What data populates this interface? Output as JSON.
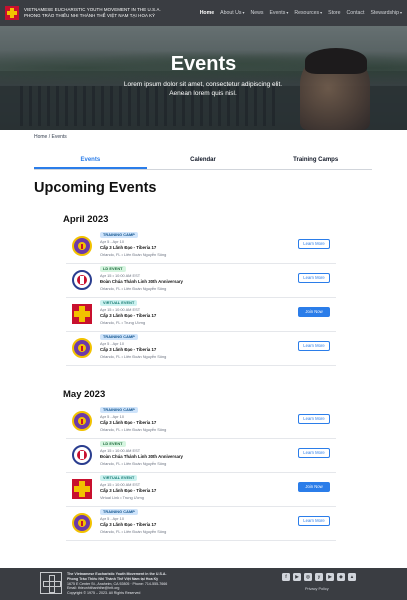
{
  "nav": {
    "org_line1": "VIETNAMESE EUCHARISTIC YOUTH MOVEMENT IN THE U.S.A.",
    "org_line2": "PHONG TRÀO THIẾU NHI THÁNH THỂ VIỆT NAM TẠI HOA KỲ",
    "links": [
      "Home",
      "About Us",
      "News",
      "Events",
      "Resources",
      "Store",
      "Contact",
      "Stewardship"
    ],
    "caret": "▾",
    "active": "Home"
  },
  "hero": {
    "title": "Events",
    "subtitle": "Lorem ipsum dolor sit amet, consectetur adipiscing elit. Aenean lorem quis nisl."
  },
  "breadcrumb": "Home / Events",
  "tabs": [
    "Events",
    "Calendar",
    "Training Camps"
  ],
  "heading": "Upcoming Events",
  "months": [
    {
      "name": "April 2023",
      "events": [
        {
          "type": "camp",
          "badge": "TRAINING CAMP",
          "date": "Apr 5 - Apr 10",
          "title": "Cấp 3 Lãnh Đạo - Tiberia 17",
          "location": "Orlando, FL  •  Liên Đoàn Nguyễn Sông",
          "button": "Learn More",
          "style": "outline"
        },
        {
          "type": "ld",
          "badge": "LD EVENT",
          "date": "Apr 15  •  10:00 AM EST",
          "title": "Đoàn Chúa Thánh Linh 30th Anniversary",
          "location": "Orlando, FL  •  Liên Đoàn Nguyễn Sông",
          "button": "Learn More",
          "style": "outline"
        },
        {
          "type": "virtual",
          "badge": "VIRTUAL EVENT",
          "date": "Apr 15  •  10:00 AM EST",
          "title": "Cấp 3 Lãnh Đạo - Tiberia 17",
          "location": "Orlando, FL  •  Trung Ương",
          "button": "Join Now",
          "style": "solid"
        },
        {
          "type": "camp",
          "badge": "TRAINING CAMP",
          "date": "Apr 5 - Apr 10",
          "title": "Cấp 3 Lãnh Đạo - Tiberia 17",
          "location": "Orlando, FL  •  Liên Đoàn Nguyễn Sông",
          "button": "Learn More",
          "style": "outline"
        }
      ]
    },
    {
      "name": "May 2023",
      "events": [
        {
          "type": "camp",
          "badge": "TRAINING CAMP",
          "date": "Apr 5 - Apr 10",
          "title": "Cấp 3 Lãnh Đạo - Tiberia 17",
          "location": "Orlando, FL  •  Liên Đoàn Nguyễn Sông",
          "button": "Learn More",
          "style": "outline"
        },
        {
          "type": "ld",
          "badge": "LD EVENT",
          "date": "Apr 15  •  10:00 AM EST",
          "title": "Đoàn Chúa Thánh Linh 30th Anniversary",
          "location": "Orlando, FL  •  Liên Đoàn Nguyễn Sông",
          "button": "Learn More",
          "style": "outline"
        },
        {
          "type": "virtual",
          "badge": "VIRTUAL EVENT",
          "date": "Apr 15  •  10:00 AM EST",
          "title": "Cấp 3 Lãnh Đạo - Tiberia 17",
          "location": "Virtual Link  •  Trung Ương",
          "button": "Join Now",
          "style": "solid"
        },
        {
          "type": "camp",
          "badge": "TRAINING CAMP",
          "date": "Apr 5 - Apr 10",
          "title": "Cấp 3 Lãnh Đạo - Tiberia 17",
          "location": "Orlando, FL  •  Liên Đoàn Nguyễn Sông",
          "button": "Learn More",
          "style": "outline"
        }
      ]
    }
  ],
  "footer": {
    "line1": "The Vietnamese Eucharistic Youth Movement in the U.S.A.",
    "line2": "Phong Trào Thiếu Nhi Thánh Thể Việt Nam tại Hoa Kỳ",
    "line3": "1675 E Center St., Anaheim, CA 92805 · Phone: 714-555-7666",
    "line4": "Email: thieunhithanhthe@tntt.org",
    "line5": "Copyright © 1975 – 2023. All Rights Reserved",
    "socials": [
      "f",
      "▶",
      "◎",
      "y",
      "▶",
      "◆",
      "▲"
    ],
    "privacy": "Privacy Policy"
  },
  "colors": {
    "accent": "#2b7de9",
    "nav_bg": "#3a3d42",
    "brand_red": "#c8102e",
    "brand_gold": "#f2c200"
  }
}
